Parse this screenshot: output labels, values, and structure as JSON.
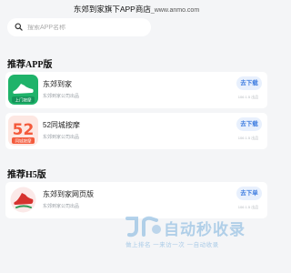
{
  "page": {
    "title": "东郊到家旗下APP商店",
    "domain": "_www.anmo.com"
  },
  "search": {
    "placeholder": "搜索APP名称",
    "value": ""
  },
  "sections": {
    "app_title": "推荐APP版",
    "h5_title": "推荐H5版"
  },
  "apps": [
    {
      "name": "东郊到家",
      "subtitle": "东郊到家公司出品",
      "button": "去下载",
      "size": "106 1.5 出品",
      "icon": "shoe-logo-icon",
      "icon_caption": "上门按摩",
      "icon_color": "#1fb36a"
    },
    {
      "name": "52同城按摩",
      "subtitle": "东郊到家公司出品",
      "button": "去下载",
      "size": "106 1.5 出品",
      "icon": "number-52-logo-icon",
      "icon_caption": "52",
      "icon_sub": "同城按摩",
      "icon_color": "#f45a3b"
    }
  ],
  "h5": [
    {
      "name": "东郊到家网页版",
      "subtitle": "东郊到家公司出品",
      "button": "去下单",
      "size": "106 1.5 出品",
      "icon": "shoe-logo-icon",
      "icon_color": "#d6332f"
    }
  ],
  "watermark": {
    "text": "自动秒收录",
    "tag": "做上排名 一来访一次 一自动收录"
  }
}
